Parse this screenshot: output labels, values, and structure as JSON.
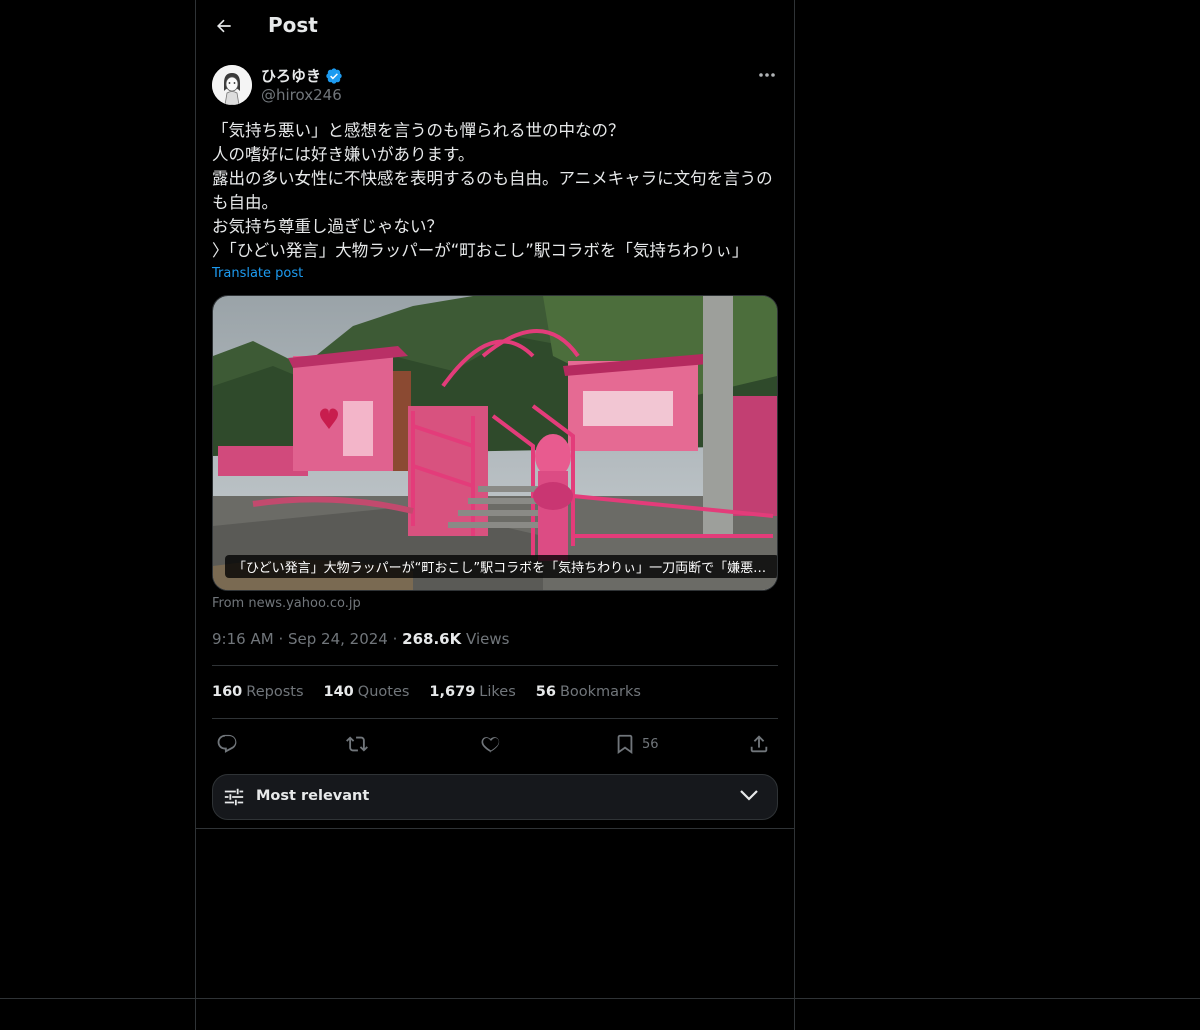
{
  "header": {
    "title": "Post"
  },
  "author": {
    "display_name": "ひろゆき",
    "handle": "@hirox246",
    "verified": true
  },
  "post": {
    "text": "「気持ち悪い」と感想を言うのも憚られる世の中なの？\n人の嗜好には好き嫌いがあります。\n露出の多い女性に不快感を表明するのも自由。アニメキャラに文句を言うのも自由。\nお気持ち尊重し過ぎじゃない？\n〉「ひどい発言」大物ラッパーが“町おこし”駅コラボを「気持ちわりぃ」",
    "translate_label": "Translate post"
  },
  "link_card": {
    "caption": "「ひどい発言」大物ラッパーが“町おこし”駅コラボを「気持ちわりぃ」一刀両断で「嫌悪感を…",
    "source": "From news.yahoo.co.jp"
  },
  "meta": {
    "time": "9:16 AM",
    "date": "Sep 24, 2024",
    "views_count": "268.6K",
    "views_label": "Views"
  },
  "stats": [
    {
      "num": "160",
      "label": "Reposts"
    },
    {
      "num": "140",
      "label": "Quotes"
    },
    {
      "num": "1,679",
      "label": "Likes"
    },
    {
      "num": "56",
      "label": "Bookmarks"
    }
  ],
  "actions": {
    "bookmark_count": "56",
    "icons": [
      "reply-icon",
      "repost-icon",
      "like-icon",
      "bookmark-icon",
      "share-icon"
    ]
  },
  "sort": {
    "label": "Most relevant"
  },
  "colors": {
    "background": "#000000",
    "border": "#2f3336",
    "text": "#e7e9ea",
    "muted": "#71767b",
    "link": "#1d9bf0",
    "verified": "#1d9bf0"
  }
}
